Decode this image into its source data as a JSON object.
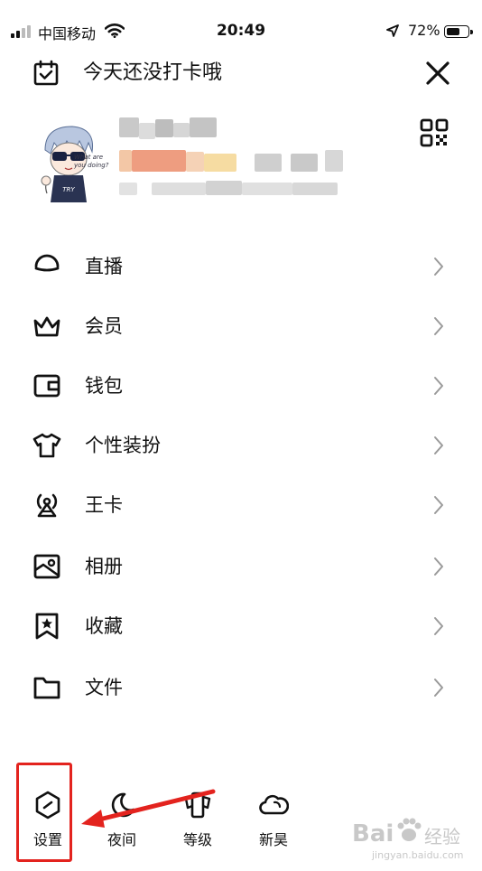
{
  "status_bar": {
    "carrier": "中国移动",
    "time": "20:49",
    "battery": "72%",
    "battery_level": 0.72
  },
  "header": {
    "checkin_text": "今天还没打卡哦"
  },
  "menu": [
    {
      "label": "直播",
      "icon": "live-icon"
    },
    {
      "label": "会员",
      "icon": "crown-icon"
    },
    {
      "label": "钱包",
      "icon": "wallet-icon"
    },
    {
      "label": "个性装扮",
      "icon": "tshirt-icon"
    },
    {
      "label": "王卡",
      "icon": "signal-tower-icon"
    },
    {
      "label": "相册",
      "icon": "photo-icon"
    },
    {
      "label": "收藏",
      "icon": "bookmark-star-icon"
    },
    {
      "label": "文件",
      "icon": "folder-icon"
    }
  ],
  "bottom_bar": [
    {
      "label": "设置",
      "icon": "settings-hexagon-icon"
    },
    {
      "label": "夜间",
      "icon": "moon-icon"
    },
    {
      "label": "等级",
      "icon": "level-icon"
    },
    {
      "label": "新昊",
      "icon": "weather-icon"
    }
  ],
  "annotation_color": "#e3231e",
  "watermark": {
    "logo": "Bai",
    "site": "jingyan.baidu.com"
  }
}
